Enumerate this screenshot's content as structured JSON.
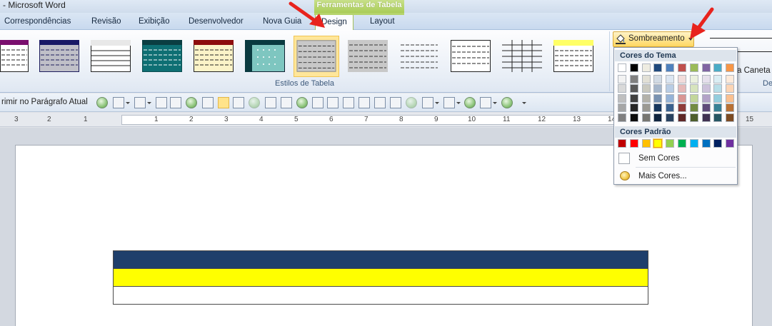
{
  "window": {
    "title": "- Microsoft Word"
  },
  "context": {
    "label": "Ferramentas de Tabela"
  },
  "tabs": [
    {
      "label": "Correspondências"
    },
    {
      "label": "Revisão"
    },
    {
      "label": "Exibição"
    },
    {
      "label": "Desenvolvedor"
    },
    {
      "label": "Nova Guia"
    },
    {
      "label": "Design"
    },
    {
      "label": "Layout"
    }
  ],
  "ribbon": {
    "styles_group_label": "Estilos de Tabela",
    "shading_button_label": "Sombreamento",
    "pen_label": "a Caneta",
    "draw_group_label": "De"
  },
  "toolbar": {
    "text_label": "rimir no Parágrafo Atual"
  },
  "ruler": {
    "numbers": [
      "3",
      "2",
      "1",
      "1",
      "2",
      "3",
      "4",
      "5",
      "6",
      "7",
      "8",
      "9",
      "10",
      "11",
      "12",
      "13",
      "14",
      "15"
    ]
  },
  "dropdown": {
    "theme_header": "Cores do Tema",
    "standard_header": "Cores Padrão",
    "no_color_label": "Sem Cores",
    "more_colors_label": "Mais Cores...",
    "theme_colors": [
      "#ffffff",
      "#000000",
      "#eeece1",
      "#1f497d",
      "#4f81bd",
      "#c0504d",
      "#9bbb59",
      "#8064a2",
      "#4bacc6",
      "#f79646"
    ],
    "standard_colors": [
      "#c00000",
      "#ff0000",
      "#ffc000",
      "#ffff00",
      "#92d050",
      "#00b050",
      "#00b0f0",
      "#0070c0",
      "#002060",
      "#7030a0"
    ]
  },
  "document": {
    "table_row_colors": [
      "#1f3f6b",
      "#ffff00",
      "#ffffff"
    ]
  }
}
